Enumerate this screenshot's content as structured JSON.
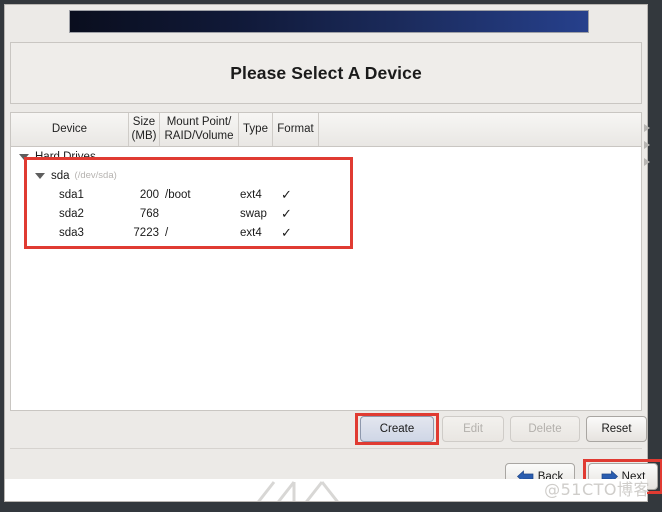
{
  "window": {
    "title": "Please Select A Device"
  },
  "table": {
    "columns": [
      {
        "id": "device",
        "label": "Device"
      },
      {
        "id": "size",
        "label": "Size\n(MB)",
        "line1": "Size",
        "line2": "(MB)"
      },
      {
        "id": "mount",
        "label": "Mount Point/\nRAID/Volume",
        "line1": "Mount Point/",
        "line2": "RAID/Volume"
      },
      {
        "id": "type",
        "label": "Type"
      },
      {
        "id": "format",
        "label": "Format"
      }
    ],
    "groups": [
      {
        "label": "Hard Drives",
        "expanded": true,
        "disks": [
          {
            "name": "sda",
            "path": "(/dev/sda)",
            "expanded": true,
            "partitions": [
              {
                "device": "sda1",
                "size": "200",
                "mount": "/boot",
                "type": "ext4",
                "format": "✓"
              },
              {
                "device": "sda2",
                "size": "768",
                "mount": "",
                "type": "swap",
                "format": "✓"
              },
              {
                "device": "sda3",
                "size": "7223",
                "mount": "/",
                "type": "ext4",
                "format": "✓"
              }
            ]
          }
        ]
      }
    ]
  },
  "actions": {
    "create": {
      "label": "Create",
      "enabled": true,
      "highlighted": true
    },
    "edit": {
      "label": "Edit",
      "enabled": false,
      "highlighted": false
    },
    "delete": {
      "label": "Delete",
      "enabled": false,
      "highlighted": false
    },
    "reset": {
      "label": "Reset",
      "enabled": true,
      "highlighted": false
    }
  },
  "navigation": {
    "back": {
      "label": "Back",
      "icon": "arrow-left-icon"
    },
    "next": {
      "label": "Next",
      "icon": "arrow-right-icon",
      "highlighted": true
    }
  },
  "annotations": {
    "highlight_color": "#e03b32",
    "boxes": [
      "partition-rows",
      "create-button",
      "next-button"
    ]
  },
  "watermark": {
    "text": "@51CTO博客"
  },
  "colors": {
    "banner_start": "#0a0e1e",
    "banner_end": "#26408c",
    "window_bg": "#eceae7",
    "accent_arrow": "#2a5db0",
    "highlight": "#e03b32"
  }
}
